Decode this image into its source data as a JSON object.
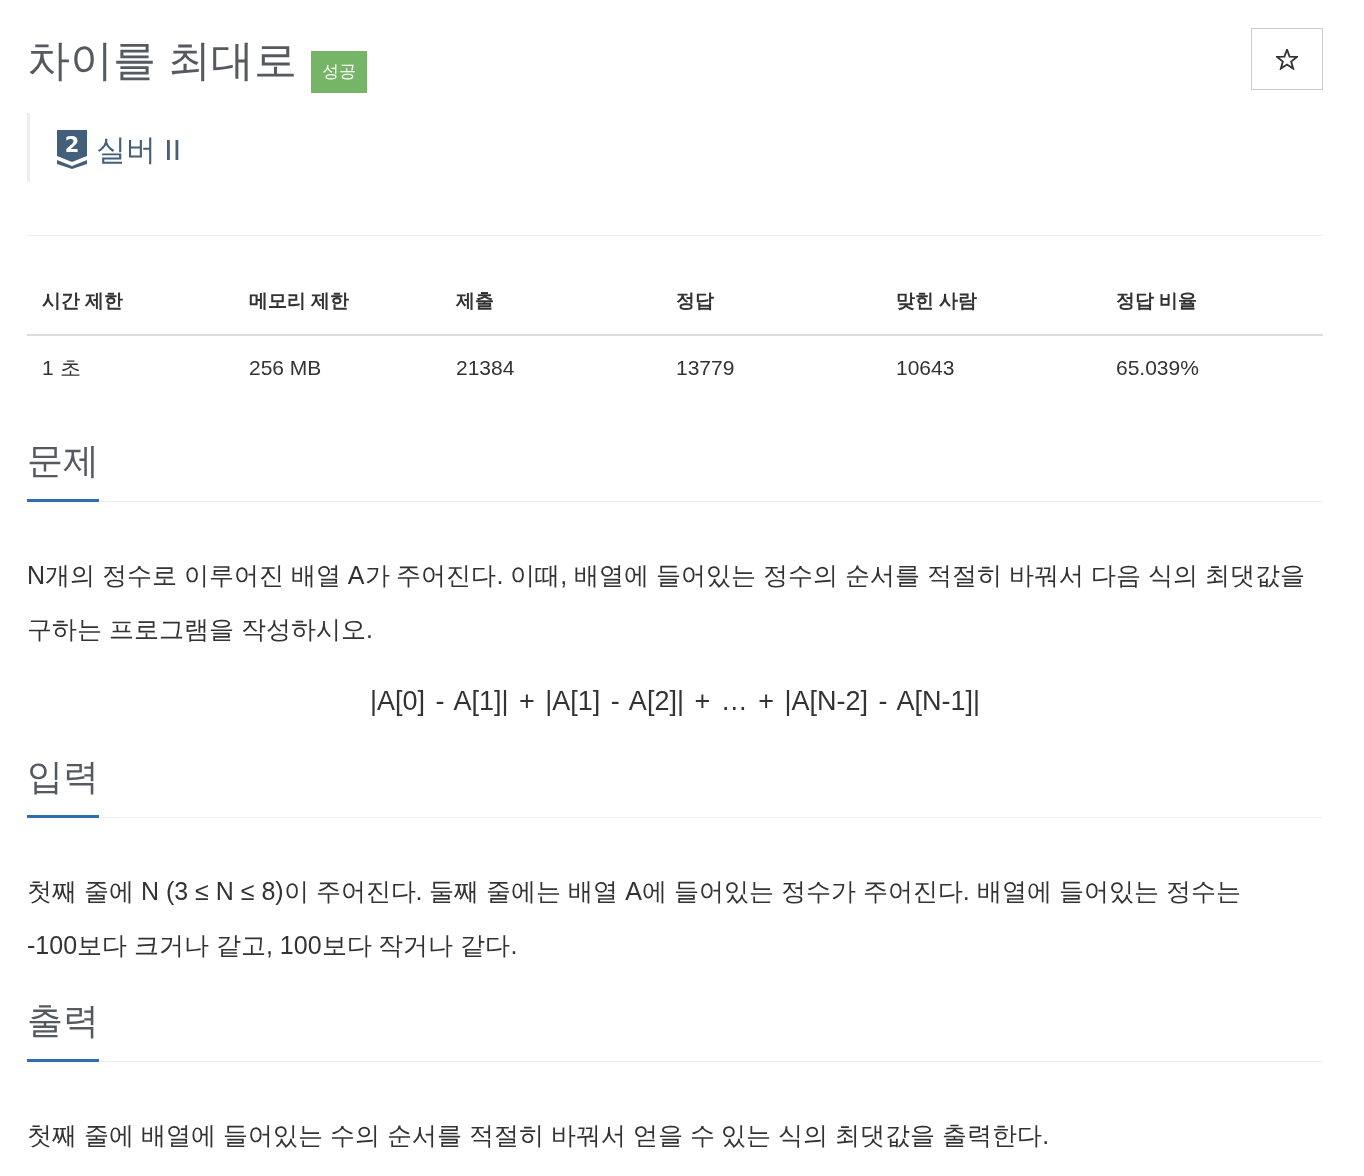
{
  "problem": {
    "title": "차이를 최대로",
    "result_badge": "성공",
    "starred": false
  },
  "tier": {
    "rank": "2",
    "label": "실버 II"
  },
  "stats": {
    "columns": [
      "시간 제한",
      "메모리 제한",
      "제출",
      "정답",
      "맞힌 사람",
      "정답 비율"
    ],
    "rows": [
      [
        "1 초",
        "256 MB",
        "21384",
        "13779",
        "10643",
        "65.039%"
      ]
    ]
  },
  "sections": [
    {
      "heading": "문제",
      "blocks": [
        {
          "kind": "paragraph",
          "text": "N개의 정수로 이루어진 배열 A가 주어진다. 이때, 배열에 들어있는 정수의 순서를 적절히 바꿔서 다음 식의 최댓값을 구하는 프로그램을 작성하시오."
        },
        {
          "kind": "formula",
          "text": "|A[0] - A[1]| + |A[1] - A[2]| + … + |A[N-2] - A[N-1]|"
        }
      ]
    },
    {
      "heading": "입력",
      "blocks": [
        {
          "kind": "paragraph",
          "text": "첫째 줄에 N (3 ≤ N ≤ 8)이 주어진다. 둘째 줄에는 배열 A에 들어있는 정수가 주어진다. 배열에 들어있는 정수는 -100보다 크거나 같고, 100보다 작거나 같다."
        }
      ]
    },
    {
      "heading": "출력",
      "blocks": [
        {
          "kind": "paragraph",
          "text": "첫째 줄에 배열에 들어있는 수의 순서를 적절히 바꿔서 얻을 수 있는 식의 최댓값을 출력한다."
        }
      ]
    }
  ]
}
